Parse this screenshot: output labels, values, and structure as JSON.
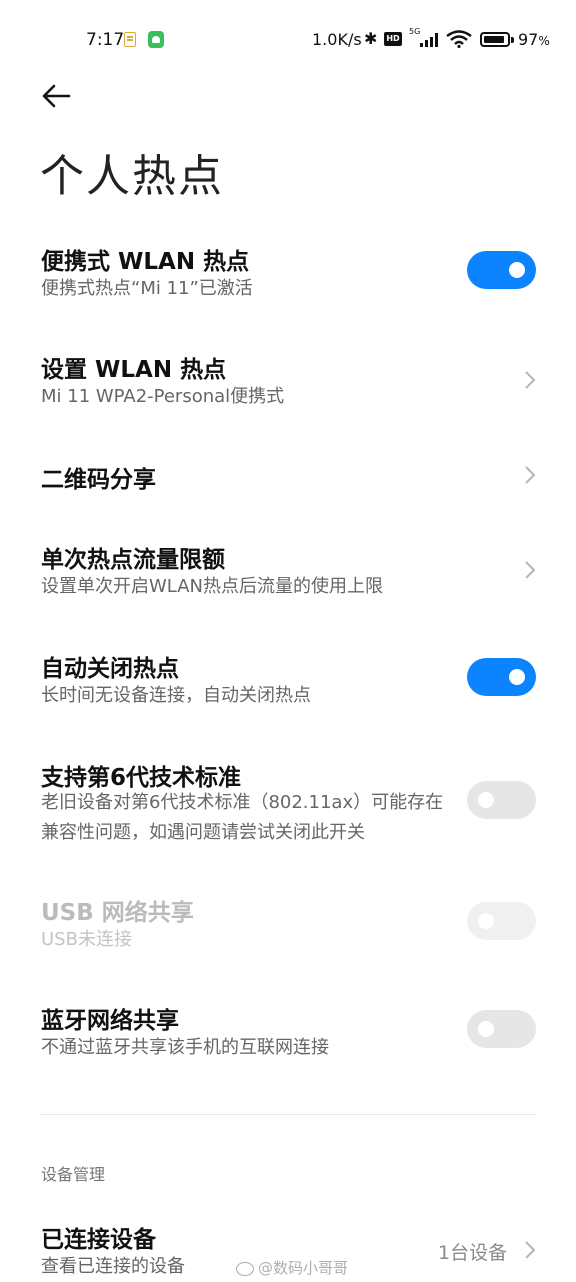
{
  "status_bar": {
    "time": "7:17",
    "net_speed": "1.0K/s",
    "bluetooth_glyph": "✱",
    "hd_label": "HD",
    "network_label": "5G",
    "battery_percent": "97",
    "battery_unit": "%",
    "icons": [
      "notes-icon",
      "android-icon",
      "bluetooth-icon",
      "hd-volte-icon",
      "signal-icon",
      "wifi-icon",
      "battery-icon"
    ]
  },
  "header": {
    "back_icon": "arrow-left-icon",
    "title": "个人热点"
  },
  "settings": [
    {
      "id": "portable-wlan-hotspot",
      "title": "便携式 WLAN 热点",
      "subtitle": "便携式热点“Mi 11”已激活",
      "control": "toggle",
      "state": "on"
    },
    {
      "id": "setup-wlan-hotspot",
      "title": "设置 WLAN 热点",
      "subtitle": "Mi 11 WPA2-Personal便携式",
      "control": "chevron"
    },
    {
      "id": "qr-share",
      "title": "二维码分享",
      "control": "chevron"
    },
    {
      "id": "data-limit",
      "title": "单次热点流量限额",
      "subtitle": "设置单次开启WLAN热点后流量的使用上限",
      "control": "chevron"
    },
    {
      "id": "auto-off",
      "title": "自动关闭热点",
      "subtitle": "长时间无设备连接，自动关闭热点",
      "control": "toggle",
      "state": "on"
    },
    {
      "id": "wifi6",
      "title": "支持第6代技术标准",
      "subtitle": "老旧设备对第6代技术标准（802.11ax）可能存在兼容性问题，如遇问题请尝试关闭此开关",
      "control": "toggle",
      "state": "off"
    },
    {
      "id": "usb-tethering",
      "title": "USB 网络共享",
      "subtitle": "USB未连接",
      "control": "toggle",
      "state": "off",
      "disabled": true
    },
    {
      "id": "bt-tethering",
      "title": "蓝牙网络共享",
      "subtitle": "不通过蓝牙共享该手机的互联网连接",
      "control": "toggle",
      "state": "off"
    }
  ],
  "device_section": {
    "header": "设备管理",
    "connected": {
      "title": "已连接设备",
      "subtitle": "查看已连接的设备",
      "value": "1台设备"
    }
  },
  "watermark": "@数码小哥哥",
  "colors": {
    "toggle_on": "#0d84ff",
    "toggle_off": "#e6e6e6",
    "text_primary": "#111111",
    "text_secondary": "#666666"
  }
}
